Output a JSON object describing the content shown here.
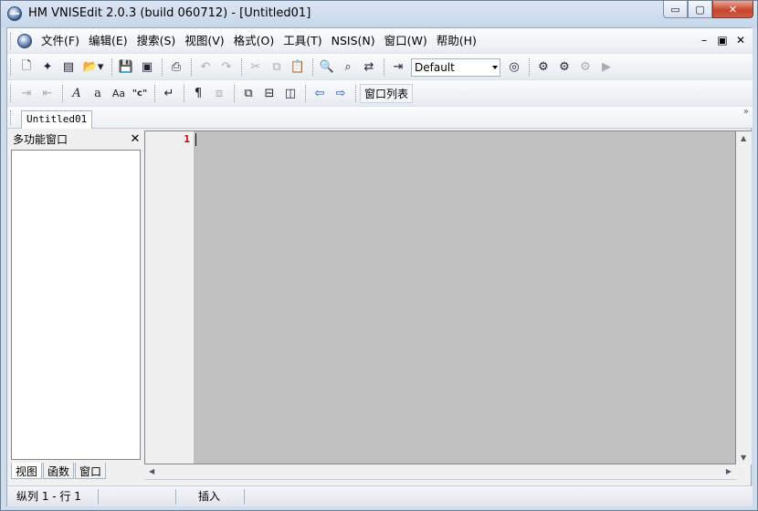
{
  "window": {
    "title": "HM VNISEdit 2.0.3 (build 060712) - [Untitled01]",
    "buttons": {
      "minimize": "▭",
      "maximize": "▢",
      "close": "✕"
    }
  },
  "menu": {
    "items": [
      "文件(F)",
      "编辑(E)",
      "搜索(S)",
      "视图(V)",
      "格式(O)",
      "工具(T)",
      "NSIS(N)",
      "窗口(W)",
      "帮助(H)"
    ],
    "mdi_buttons": [
      "–",
      "▣",
      "✕"
    ]
  },
  "toolbar1": {
    "style_combo": "Default"
  },
  "toolbar2": {
    "window_list_label": "窗口列表"
  },
  "tabs": {
    "doc_tab": "Untitled01",
    "more": "»"
  },
  "panel": {
    "title": "多功能窗口",
    "close": "✕",
    "tabs": [
      "视图",
      "函数",
      "窗口"
    ]
  },
  "editor": {
    "line_number": "1"
  },
  "statusbar": {
    "position": "纵列 1 - 行 1",
    "mode": "插入"
  }
}
